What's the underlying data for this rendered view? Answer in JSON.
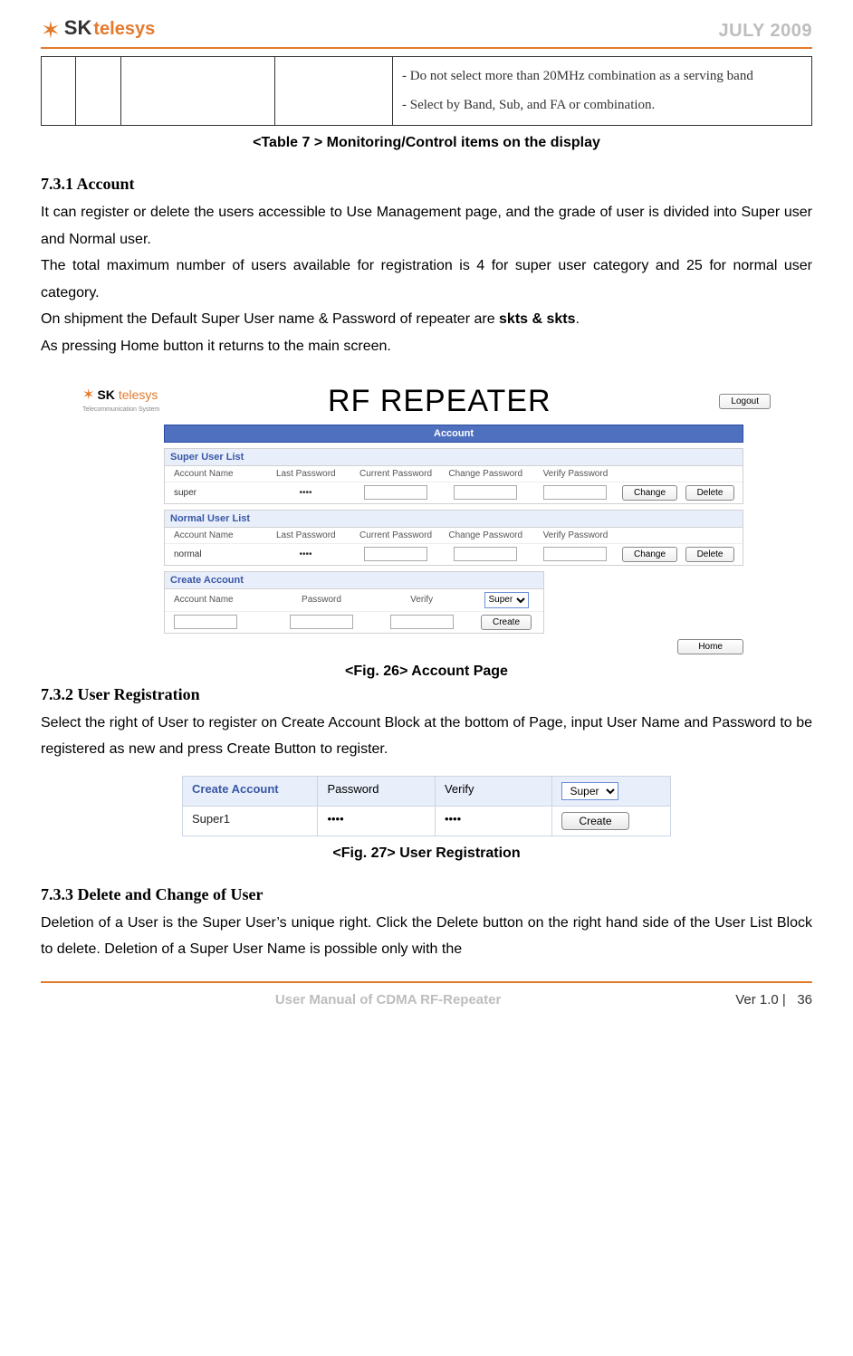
{
  "header": {
    "brand_sk": "SK",
    "brand_telesys": "telesys",
    "date": "JULY 2009"
  },
  "top_table": {
    "note": "- Do not select more than 20MHz combination as a serving band\n- Select by Band, Sub, and FA or combination."
  },
  "table_caption": "<Table 7 > Monitoring/Control items on the display",
  "s731": {
    "title": "7.3.1 Account",
    "p1a": "It can register or delete the users accessible to Use Management page, and the grade of user is divided into Super user and Normal user.",
    "p1b": "The total maximum number of users available for registration is 4 for super user category and 25 for normal user category.",
    "p1c_pre": "On shipment the Default Super User name & Password of repeater are ",
    "p1c_bold": "skts & skts",
    "p1c_post": ".",
    "p1d": "As pressing Home button it returns to the main screen."
  },
  "fig26": {
    "brand_sk": "SK",
    "brand_telesys": "telesys",
    "brand_sub": "Telecommunication System",
    "title": "RF REPEATER",
    "logout": "Logout",
    "account_bar": "Account",
    "super_list": "Super User List",
    "normal_list": "Normal User List",
    "cols": {
      "acct": "Account Name",
      "last": "Last Password",
      "curr": "Current Password",
      "chg": "Change Password",
      "ver": "Verify Password"
    },
    "rows": {
      "super_name": "super",
      "super_mask": "••••",
      "normal_name": "normal",
      "normal_mask": "••••"
    },
    "btn_change": "Change",
    "btn_delete": "Delete",
    "create_title": "Create Account",
    "create_cols": {
      "acct": "Account Name",
      "pw": "Password",
      "ver": "Verify"
    },
    "create_select": "Super",
    "btn_create": "Create",
    "btn_home": "Home",
    "caption": "<Fig. 26> Account Page"
  },
  "s732": {
    "title": "7.3.2 User Registration",
    "p": "Select the right of User to register on Create Account Block at the bottom of Page, input User Name and Password to be registered as new and press Create Button to register."
  },
  "fig27": {
    "head": {
      "a": "Create Account",
      "b": "Password",
      "c": "Verify"
    },
    "body": {
      "a": "Super1",
      "b": "••••",
      "c": "••••",
      "sel": "Super",
      "btn": "Create"
    },
    "caption": "<Fig. 27> User Registration"
  },
  "s733": {
    "title": "7.3.3 Delete and Change of User",
    "p": "Deletion of a User is the Super User’s unique right. Click the Delete button on the right hand side of the User List Block to delete. Deletion of a Super User Name is possible only with the"
  },
  "footer": {
    "left": "User Manual of CDMA RF-Repeater",
    "right_label": "Ver 1.0 |",
    "page": "36"
  }
}
